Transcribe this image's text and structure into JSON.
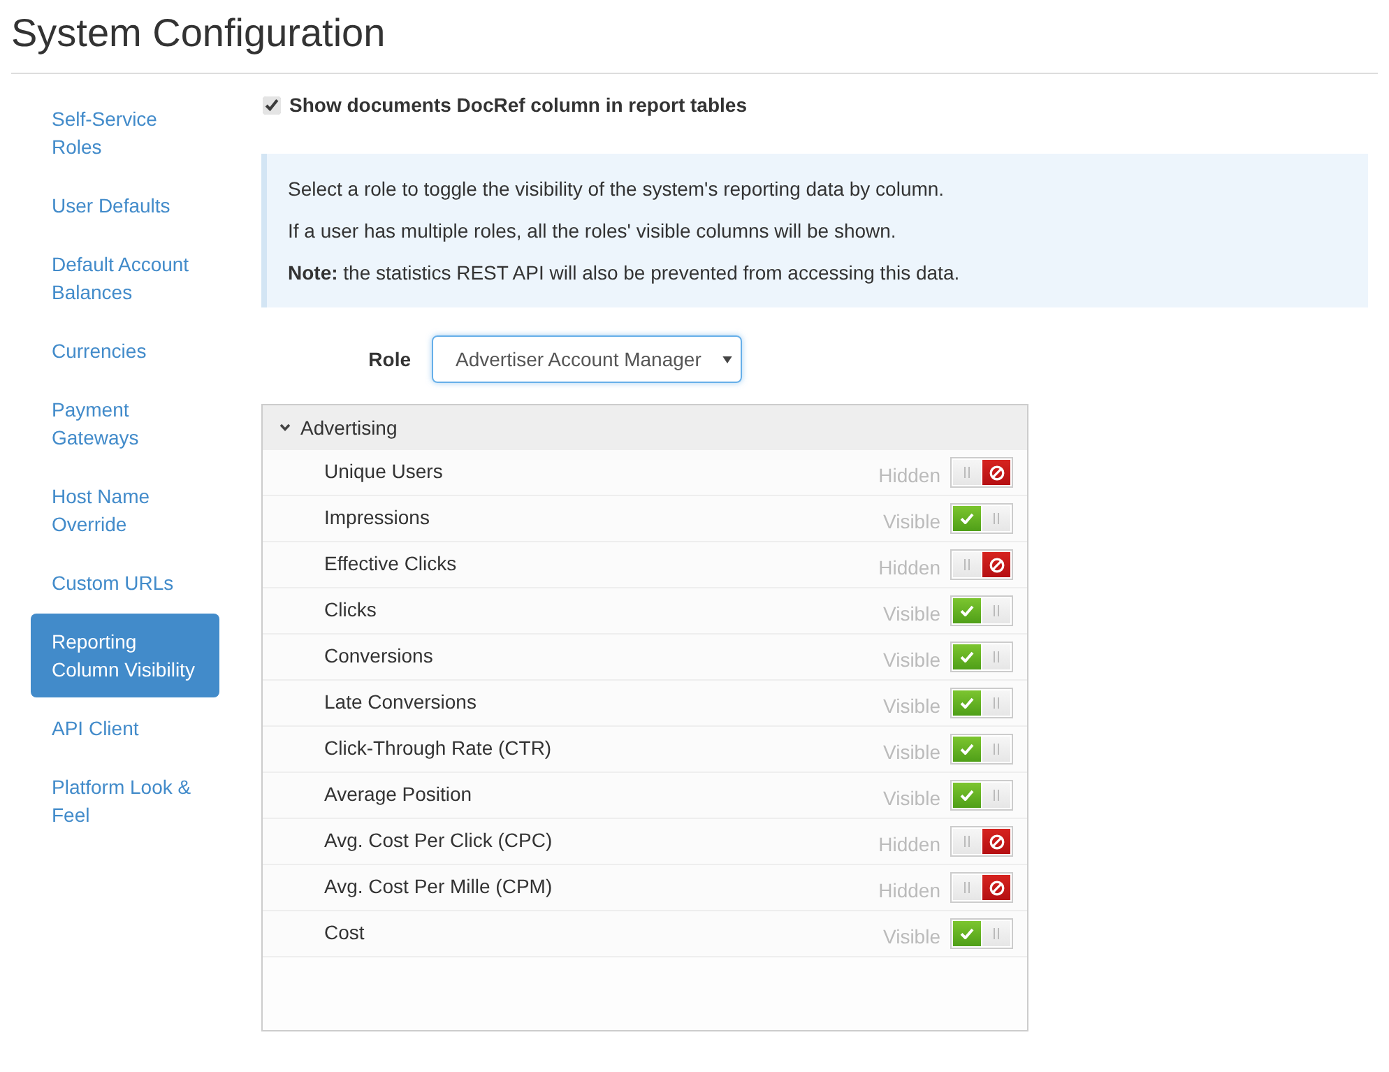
{
  "title": "System Configuration",
  "sidebar": {
    "items": [
      {
        "label": "Self-Service Roles",
        "selected": false
      },
      {
        "label": "User Defaults",
        "selected": false
      },
      {
        "label": "Default Account Balances",
        "selected": false
      },
      {
        "label": "Currencies",
        "selected": false
      },
      {
        "label": "Payment Gateways",
        "selected": false
      },
      {
        "label": "Host Name Override",
        "selected": false
      },
      {
        "label": "Custom URLs",
        "selected": false
      },
      {
        "label": "Reporting Column Visibility",
        "selected": true
      },
      {
        "label": "API Client",
        "selected": false
      },
      {
        "label": "Platform Look & Feel",
        "selected": false
      }
    ]
  },
  "show_docref": {
    "label": "Show documents DocRef column in report tables",
    "checked": true
  },
  "info": {
    "lines": [
      "Select a role to toggle the visibility of the system's reporting data by column.",
      "If a user has multiple roles, all the roles' visible columns will be shown.",
      "**Note:** the statistics REST API will also be prevented from accessing this data."
    ]
  },
  "role": {
    "label": "Role",
    "value": "Advertiser Account Manager"
  },
  "groups": [
    {
      "name": "Advertising",
      "expanded": true,
      "columns": [
        {
          "name": "Unique Users",
          "status": "Hidden",
          "visible": false
        },
        {
          "name": "Impressions",
          "status": "Visible",
          "visible": true
        },
        {
          "name": "Effective Clicks",
          "status": "Hidden",
          "visible": false
        },
        {
          "name": "Clicks",
          "status": "Visible",
          "visible": true
        },
        {
          "name": "Conversions",
          "status": "Visible",
          "visible": true
        },
        {
          "name": "Late Conversions",
          "status": "Visible",
          "visible": true
        },
        {
          "name": "Click-Through Rate (CTR)",
          "status": "Visible",
          "visible": true
        },
        {
          "name": "Average Position",
          "status": "Visible",
          "visible": true
        },
        {
          "name": "Avg. Cost Per Click (CPC)",
          "status": "Hidden",
          "visible": false
        },
        {
          "name": "Avg. Cost Per Mille (CPM)",
          "status": "Hidden",
          "visible": false
        },
        {
          "name": "Cost",
          "status": "Visible",
          "visible": true
        }
      ]
    }
  ]
}
